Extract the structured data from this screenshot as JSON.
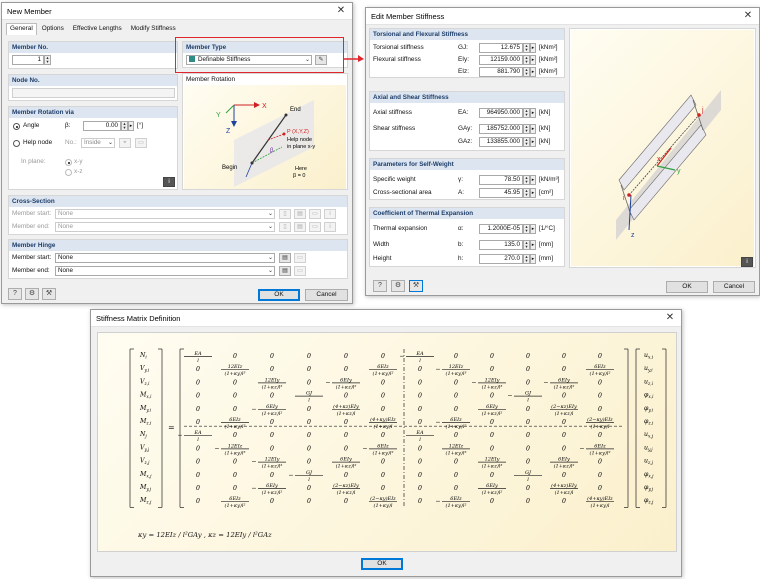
{
  "new_member": {
    "title": "New Member",
    "tabs": [
      "General",
      "Options",
      "Effective Lengths",
      "Modify Stiffness"
    ],
    "member_no_head": "Member No.",
    "member_no": "1",
    "node_no_head": "Node No.",
    "member_type_head": "Member Type",
    "member_type": "Definable Stiffness",
    "member_rotation_head": "Member Rotation",
    "member_rotation_via_head": "Member Rotation via",
    "angle_label": "Angle",
    "beta": "β:",
    "angle_value": "0.00",
    "angle_unit": "[°]",
    "help_node_label": "Help node",
    "no_label": "No.:",
    "help_node_value": "Inside",
    "in_plane_label": "In plane:",
    "xy": "x-y",
    "xz": "x-z",
    "illus": {
      "x": "X",
      "z": "Z",
      "y": "Y",
      "end": "End",
      "begin": "Begin",
      "pxyz": "P (X,Y,Z)",
      "help1": "Help node",
      "help2": "in plane x-y",
      "here1": "Here",
      "here2": "β = 0",
      "b": "β"
    },
    "cross_section_head": "Cross-Section",
    "member_start_label": "Member start:",
    "member_end_label": "Member end:",
    "none": "None",
    "member_hinge_head": "Member Hinge",
    "hinge_start_label": "Member start:",
    "hinge_end_label": "Member end:",
    "ok": "OK",
    "cancel": "Cancel"
  },
  "edit_stiffness": {
    "title": "Edit Member Stiffness",
    "torsional_head": "Torsional and Flexural Stiffness",
    "rows1": [
      {
        "label": "Torsional stiffness",
        "sym": "GJ:",
        "value": "12.675",
        "unit": "[kNm²]"
      },
      {
        "label": "Flexural stiffness",
        "sym": "EIy:",
        "value": "12159.000",
        "unit": "[kNm²]"
      },
      {
        "label": "",
        "sym": "EIz:",
        "value": "881.790",
        "unit": "[kNm²]"
      }
    ],
    "axial_head": "Axial and Shear Stiffness",
    "rows2": [
      {
        "label": "Axial stiffness",
        "sym": "EA:",
        "value": "964950.000",
        "unit": "[kN]"
      },
      {
        "label": "Shear stiffness",
        "sym": "GAy:",
        "value": "185752.000",
        "unit": "[kN]"
      },
      {
        "label": "",
        "sym": "GAz:",
        "value": "133855.000",
        "unit": "[kN]"
      }
    ],
    "self_weight_head": "Parameters for Self-Weight",
    "rows3": [
      {
        "label": "Specific weight",
        "sym": "γ:",
        "value": "78.50",
        "unit": "[kN/m³]"
      },
      {
        "label": "Cross-sectional area",
        "sym": "A:",
        "value": "45.95",
        "unit": "[cm²]"
      }
    ],
    "thermal_head": "Coefficient of Thermal Expansion",
    "rows4": [
      {
        "label": "Thermal expansion",
        "sym": "α:",
        "value": "1.2000E-05",
        "unit": "[1/°C]"
      },
      {
        "label": "Width",
        "sym": "b:",
        "value": "135.0",
        "unit": "[mm]"
      },
      {
        "label": "Height",
        "sym": "h:",
        "value": "270.0",
        "unit": "[mm]"
      }
    ],
    "axes": {
      "x": "x",
      "y": "y",
      "z": "z",
      "i": "i",
      "j": "j"
    },
    "ok": "OK",
    "cancel": "Cancel"
  },
  "stiffness_matrix": {
    "title": "Stiffness Matrix Definition",
    "left_vector": [
      "N",
      "V",
      "V",
      "M",
      "M",
      "M",
      "N",
      "V",
      "V",
      "M",
      "M",
      "M"
    ],
    "left_sub": [
      "i",
      "y,i",
      "z,i",
      "x,i",
      "y,i",
      "z,i",
      "j",
      "y,j",
      "z,j",
      "x,j",
      "y,j",
      "z,j"
    ],
    "right_vector": [
      "u",
      "u",
      "u",
      "φ",
      "φ",
      "φ",
      "u",
      "u",
      "u",
      "φ",
      "φ",
      "φ"
    ],
    "right_sub": [
      "x,i",
      "y,i",
      "z,i",
      "x,i",
      "y,i",
      "z,i",
      "x,j",
      "y,j",
      "z,j",
      "x,j",
      "y,j",
      "z,j"
    ],
    "footnote": "κy = 12EIz / l²GAy ,  κz = 12EIy / l²GAz",
    "ok": "OK"
  },
  "colors": {
    "accent": "#1d3d6b",
    "highlight": "#e0262c",
    "header_bg": "#dde6f0"
  }
}
